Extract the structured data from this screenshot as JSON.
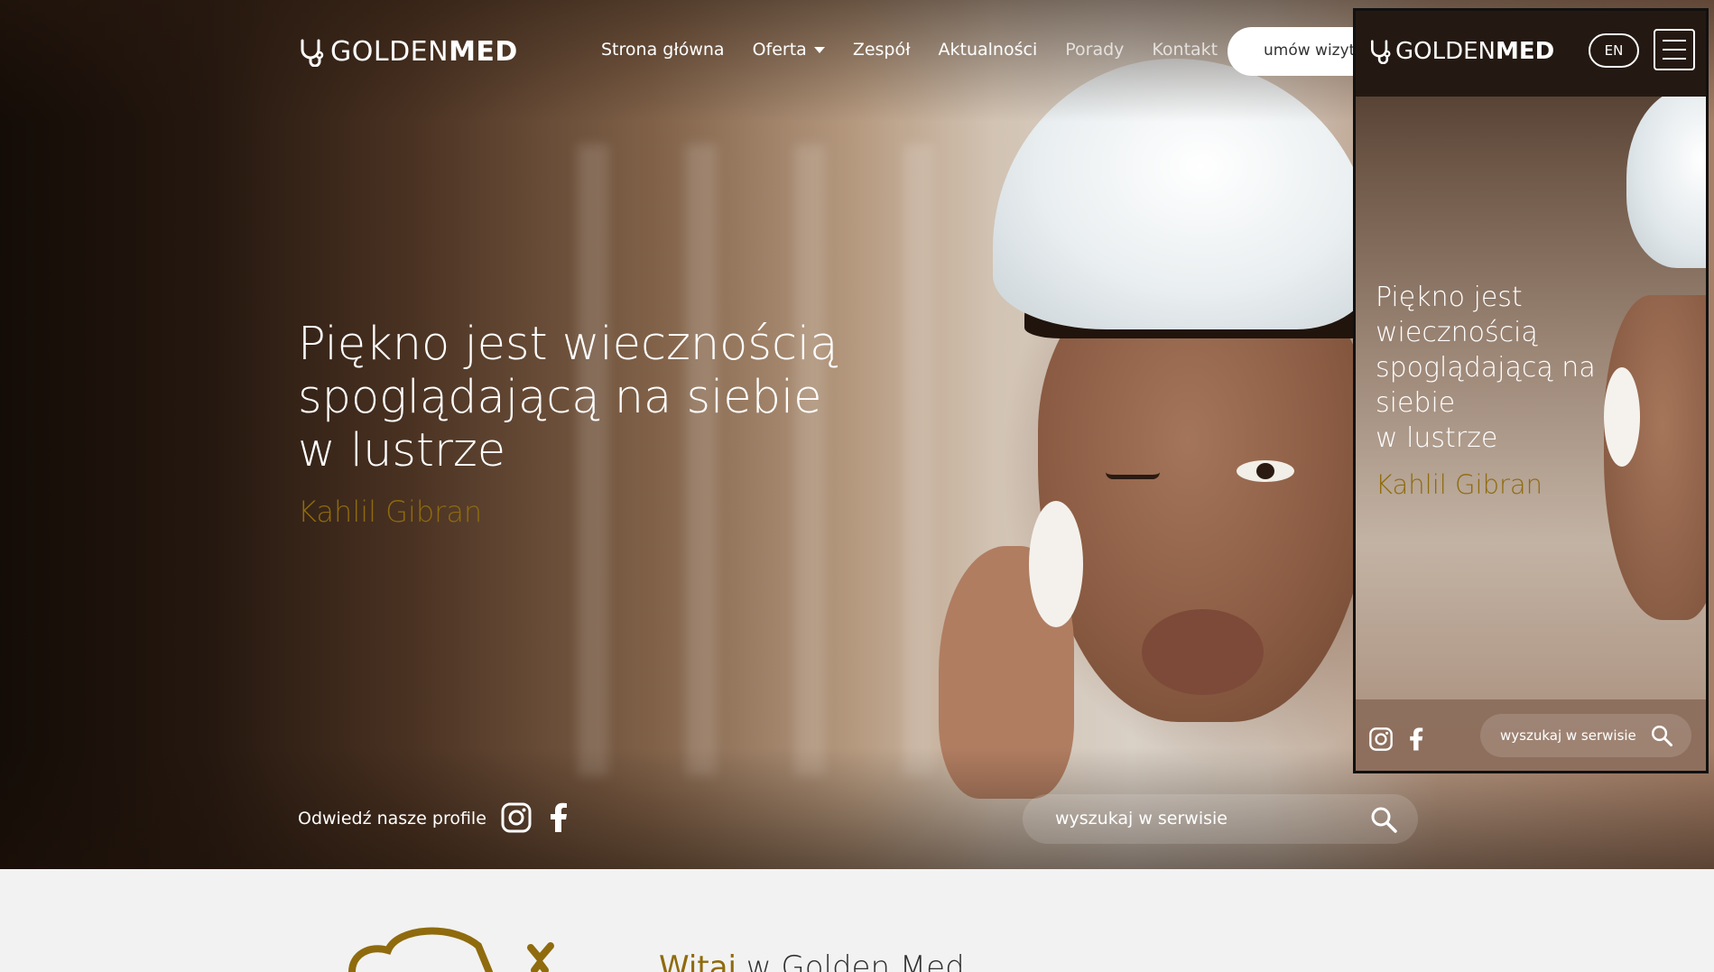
{
  "header": {
    "logo_text_light": "GOLDEN",
    "logo_text_bold": "MED",
    "nav": [
      {
        "label": "Strona główna"
      },
      {
        "label": "Oferta"
      },
      {
        "label": "Zespół"
      },
      {
        "label": "Aktualności"
      },
      {
        "label": "Porady"
      },
      {
        "label": "Kontakt"
      }
    ],
    "cta_label": "umów wizytę"
  },
  "hero": {
    "quote_lines": [
      "Piękno jest wiecznością",
      "spoglądającą na siebie",
      "w lustrze"
    ],
    "author": "Kahlil Gibran"
  },
  "bottom_bar": {
    "profiles_label": "Odwiedź nasze profile",
    "search_placeholder": "wyszukaj w serwisie"
  },
  "welcome": {
    "accent": "Witaj",
    "rest": " w Golden Med"
  },
  "mobile": {
    "lang_label": "EN",
    "quote_lines": [
      "Piękno jest",
      "wiecznością",
      "spoglądającą na",
      "siebie",
      "w lustrze"
    ],
    "author": "Kahlil Gibran",
    "search_placeholder": "wyszukaj w serwisie"
  },
  "icons": {
    "logo": "stethoscope-icon",
    "social": [
      "instagram-icon",
      "facebook-icon"
    ],
    "search": "search-icon",
    "menu": "hamburger-menu-icon",
    "dropdown": "caret-down-icon"
  },
  "colors": {
    "accent_gold": "#8f6b0d",
    "text_light": "#ffffff",
    "page_bg": "#f2f2f2"
  }
}
